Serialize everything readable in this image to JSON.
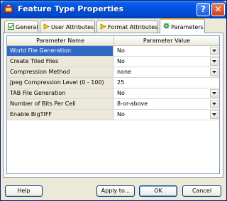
{
  "window": {
    "title": "Feature Type Properties",
    "help_glyph": "?",
    "close_glyph": "✕"
  },
  "tabs": [
    {
      "label": "General",
      "icon": "general-icon",
      "active": false
    },
    {
      "label": "User Attributes",
      "icon": "user-attributes-icon",
      "active": false
    },
    {
      "label": "Format Attributes",
      "icon": "format-attributes-icon",
      "active": false
    },
    {
      "label": "Parameters",
      "icon": "gear-icon",
      "active": true
    }
  ],
  "grid": {
    "columns": [
      "Parameter Name",
      "Parameter Value"
    ],
    "rows": [
      {
        "name": "World File Generation",
        "value": "No",
        "selected": true,
        "dropdown": true
      },
      {
        "name": "Create Tiled Files",
        "value": "No",
        "selected": false,
        "dropdown": true
      },
      {
        "name": "Compression Method",
        "value": "none",
        "selected": false,
        "dropdown": true
      },
      {
        "name": "Jpeg Compression Level (0 - 100)",
        "value": "25",
        "selected": false,
        "dropdown": false
      },
      {
        "name": "TAB File Generation",
        "value": "No",
        "selected": false,
        "dropdown": true
      },
      {
        "name": "Number of Bits Per Cell",
        "value": "8-or-above",
        "selected": false,
        "dropdown": true
      },
      {
        "name": "Enable BigTIFF",
        "value": "No",
        "selected": false,
        "dropdown": true
      }
    ]
  },
  "buttons": {
    "help": "Help",
    "apply": "Apply to...",
    "ok": "OK",
    "cancel": "Cancel"
  },
  "colors": {
    "titlebar": "#0054e3",
    "selection": "#316ac5",
    "active_tab_accent": "#ffc83c"
  }
}
